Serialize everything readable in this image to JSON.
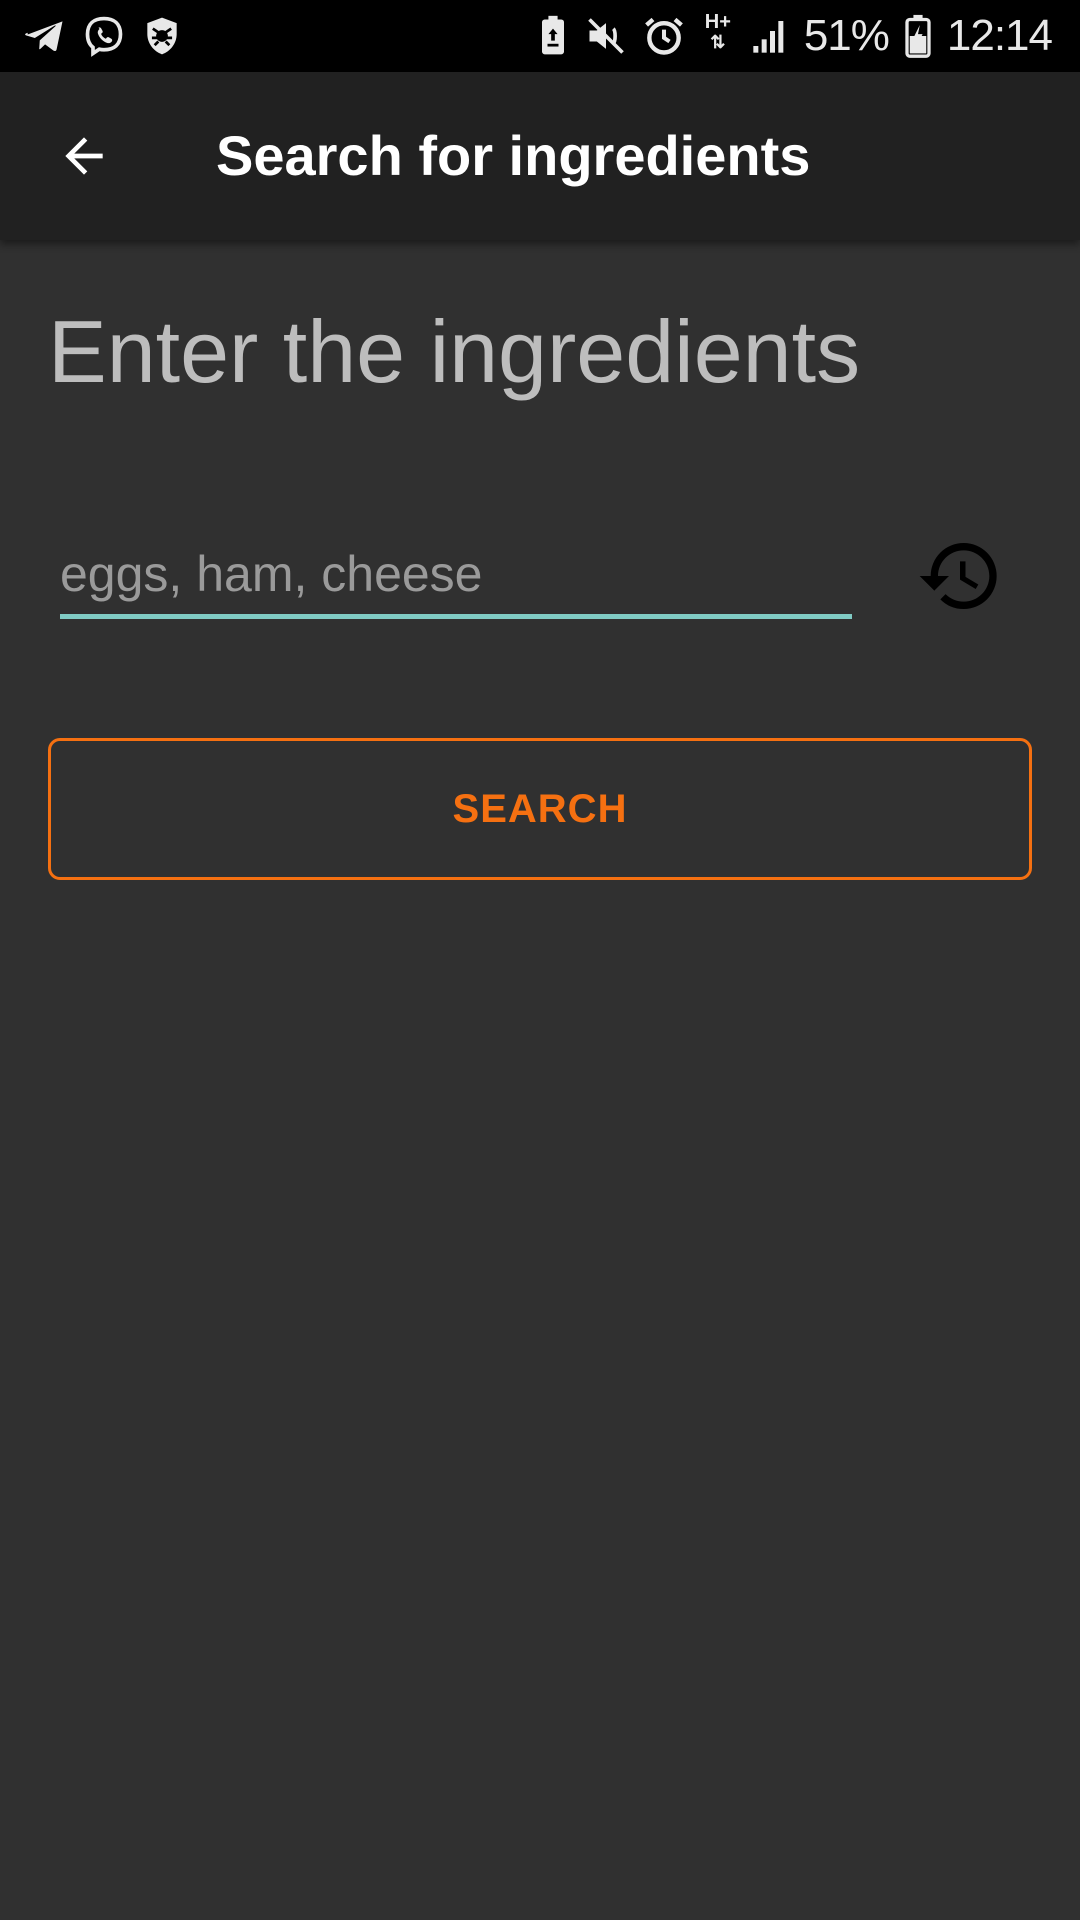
{
  "status_bar": {
    "battery_percent": "51%",
    "time": "12:14",
    "network_type": "H+",
    "left_icons": [
      "telegram-icon",
      "viber-icon",
      "antivirus-icon"
    ],
    "right_icons": [
      "battery-saver-icon",
      "mute-icon",
      "alarm-icon",
      "signal-icon",
      "battery-icon"
    ]
  },
  "app_bar": {
    "title": "Search for ingredients",
    "back_icon": "arrow-back-icon"
  },
  "main": {
    "heading": "Enter the ingredients",
    "input": {
      "placeholder": "eggs, ham, cheese",
      "value": ""
    },
    "history_icon": "history-icon",
    "search_button_label": "SEARCH"
  },
  "colors": {
    "background": "#303030",
    "app_bar": "#212121",
    "accent": "#f57011",
    "input_underline": "#80cbc4"
  }
}
